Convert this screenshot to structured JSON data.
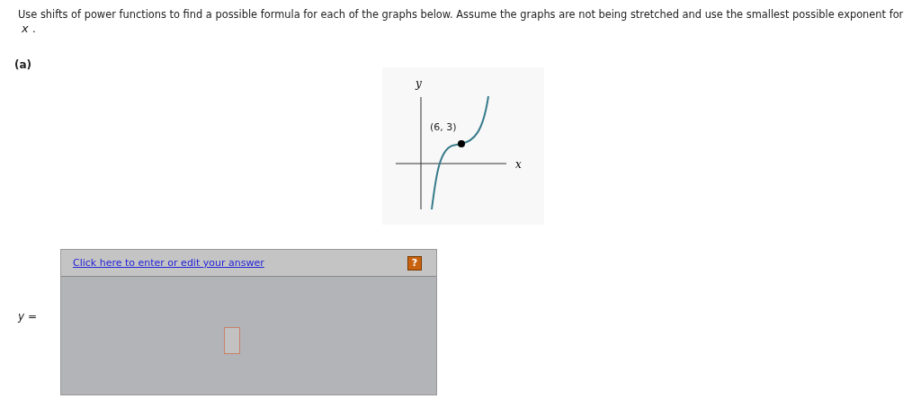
{
  "instruction": "Use shifts of power functions to find a possible formula for each of the graphs below. Assume the graphs are not being stretched and use the smallest possible exponent for",
  "variable_note": "*x* .",
  "part_label": "(a)",
  "graph": {
    "y_label": "y",
    "x_label": "x",
    "point_label": "(6, 3)"
  },
  "answer": {
    "prompt": "y =",
    "link": "Click here to enter or edit your answer",
    "help": "?"
  }
}
